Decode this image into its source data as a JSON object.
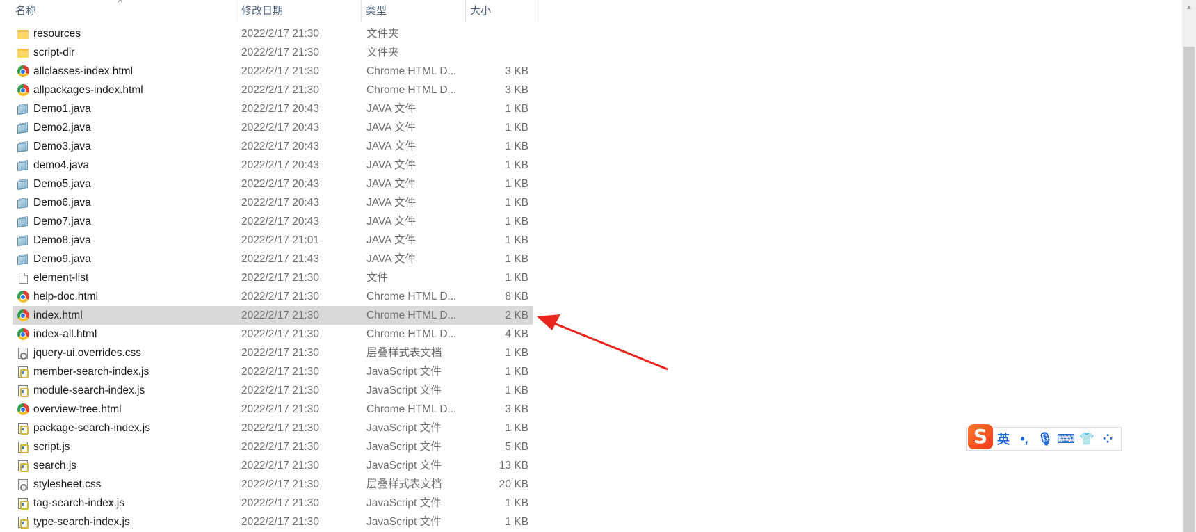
{
  "columns": {
    "name": "名称",
    "date": "修改日期",
    "type": "类型",
    "size": "大小"
  },
  "sort": {
    "column": "name",
    "indicator": "^"
  },
  "files": [
    {
      "name": "resources",
      "date": "2022/2/17 21:30",
      "type": "文件夹",
      "size": "",
      "icon": "folder-icon"
    },
    {
      "name": "script-dir",
      "date": "2022/2/17 21:30",
      "type": "文件夹",
      "size": "",
      "icon": "folder-icon"
    },
    {
      "name": "allclasses-index.html",
      "date": "2022/2/17 21:30",
      "type": "Chrome HTML D...",
      "size": "3 KB",
      "icon": "chrome-icon"
    },
    {
      "name": "allpackages-index.html",
      "date": "2022/2/17 21:30",
      "type": "Chrome HTML D...",
      "size": "3 KB",
      "icon": "chrome-icon"
    },
    {
      "name": "Demo1.java",
      "date": "2022/2/17 20:43",
      "type": "JAVA 文件",
      "size": "1 KB",
      "icon": "java-file-icon"
    },
    {
      "name": "Demo2.java",
      "date": "2022/2/17 20:43",
      "type": "JAVA 文件",
      "size": "1 KB",
      "icon": "java-file-icon"
    },
    {
      "name": "Demo3.java",
      "date": "2022/2/17 20:43",
      "type": "JAVA 文件",
      "size": "1 KB",
      "icon": "java-file-icon"
    },
    {
      "name": "demo4.java",
      "date": "2022/2/17 20:43",
      "type": "JAVA 文件",
      "size": "1 KB",
      "icon": "java-file-icon"
    },
    {
      "name": "Demo5.java",
      "date": "2022/2/17 20:43",
      "type": "JAVA 文件",
      "size": "1 KB",
      "icon": "java-file-icon"
    },
    {
      "name": "Demo6.java",
      "date": "2022/2/17 20:43",
      "type": "JAVA 文件",
      "size": "1 KB",
      "icon": "java-file-icon"
    },
    {
      "name": "Demo7.java",
      "date": "2022/2/17 20:43",
      "type": "JAVA 文件",
      "size": "1 KB",
      "icon": "java-file-icon"
    },
    {
      "name": "Demo8.java",
      "date": "2022/2/17 21:01",
      "type": "JAVA 文件",
      "size": "1 KB",
      "icon": "java-file-icon"
    },
    {
      "name": "Demo9.java",
      "date": "2022/2/17 21:43",
      "type": "JAVA 文件",
      "size": "1 KB",
      "icon": "java-file-icon"
    },
    {
      "name": "element-list",
      "date": "2022/2/17 21:30",
      "type": "文件",
      "size": "1 KB",
      "icon": "blank-file-icon"
    },
    {
      "name": "help-doc.html",
      "date": "2022/2/17 21:30",
      "type": "Chrome HTML D...",
      "size": "8 KB",
      "icon": "chrome-icon"
    },
    {
      "name": "index.html",
      "date": "2022/2/17 21:30",
      "type": "Chrome HTML D...",
      "size": "2 KB",
      "icon": "chrome-icon",
      "selected": true
    },
    {
      "name": "index-all.html",
      "date": "2022/2/17 21:30",
      "type": "Chrome HTML D...",
      "size": "4 KB",
      "icon": "chrome-icon"
    },
    {
      "name": "jquery-ui.overrides.css",
      "date": "2022/2/17 21:30",
      "type": "层叠样式表文档",
      "size": "1 KB",
      "icon": "css-file-icon"
    },
    {
      "name": "member-search-index.js",
      "date": "2022/2/17 21:30",
      "type": "JavaScript 文件",
      "size": "1 KB",
      "icon": "js-file-icon"
    },
    {
      "name": "module-search-index.js",
      "date": "2022/2/17 21:30",
      "type": "JavaScript 文件",
      "size": "1 KB",
      "icon": "js-file-icon"
    },
    {
      "name": "overview-tree.html",
      "date": "2022/2/17 21:30",
      "type": "Chrome HTML D...",
      "size": "3 KB",
      "icon": "chrome-icon"
    },
    {
      "name": "package-search-index.js",
      "date": "2022/2/17 21:30",
      "type": "JavaScript 文件",
      "size": "1 KB",
      "icon": "js-file-icon"
    },
    {
      "name": "script.js",
      "date": "2022/2/17 21:30",
      "type": "JavaScript 文件",
      "size": "5 KB",
      "icon": "js-file-icon"
    },
    {
      "name": "search.js",
      "date": "2022/2/17 21:30",
      "type": "JavaScript 文件",
      "size": "13 KB",
      "icon": "js-file-icon"
    },
    {
      "name": "stylesheet.css",
      "date": "2022/2/17 21:30",
      "type": "层叠样式表文档",
      "size": "20 KB",
      "icon": "css-file-icon"
    },
    {
      "name": "tag-search-index.js",
      "date": "2022/2/17 21:30",
      "type": "JavaScript 文件",
      "size": "1 KB",
      "icon": "js-file-icon"
    },
    {
      "name": "type-search-index.js",
      "date": "2022/2/17 21:30",
      "type": "JavaScript 文件",
      "size": "1 KB",
      "icon": "js-file-icon"
    }
  ],
  "ime": {
    "logo": "S",
    "items": [
      {
        "label": "英",
        "icon": "language-icon"
      },
      {
        "label": "•,",
        "icon": "punctuation-icon"
      },
      {
        "label": "🎙",
        "icon": "microphone-icon"
      },
      {
        "label": "⌨",
        "icon": "keyboard-icon"
      },
      {
        "label": "👕",
        "icon": "skin-icon"
      },
      {
        "label": "⁘",
        "icon": "toolbox-icon"
      }
    ]
  },
  "colors": {
    "selected_row": "#d9d9d9",
    "annotation_arrow": "#e8261d",
    "ime_accent": "#1f66d6"
  }
}
